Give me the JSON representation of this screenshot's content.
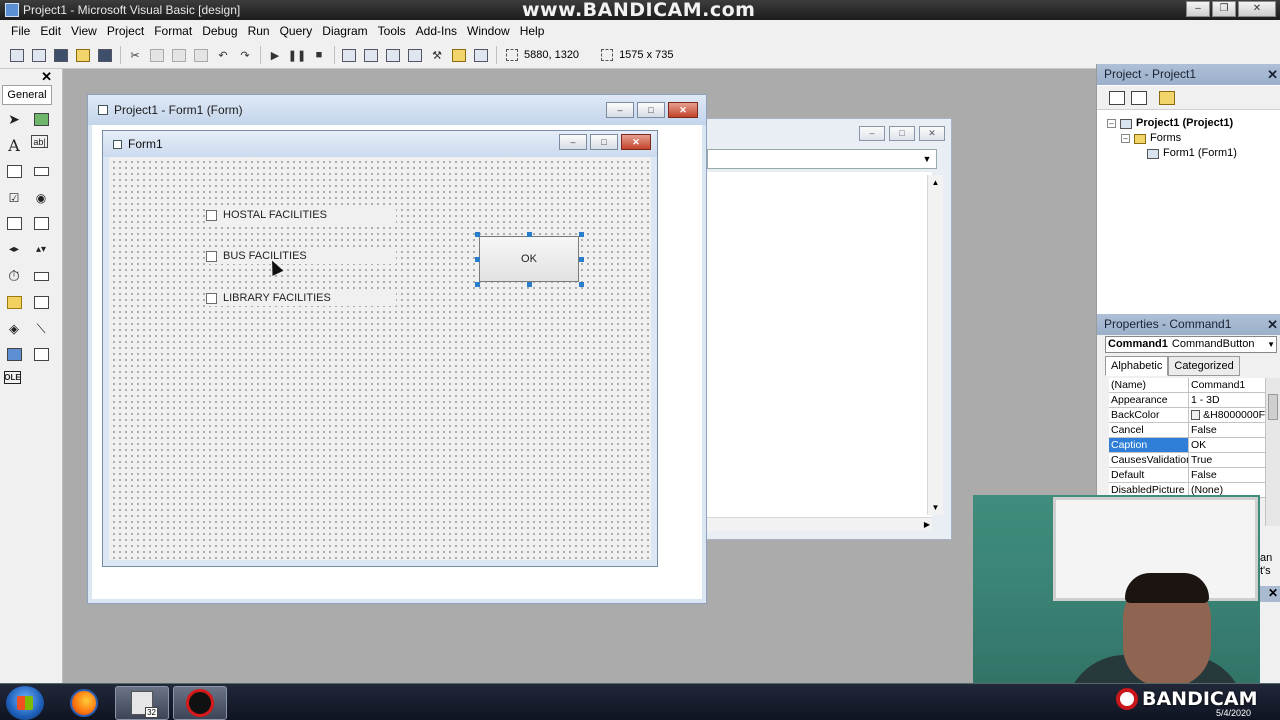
{
  "window": {
    "title": "Project1 - Microsoft Visual Basic [design]",
    "watermark": "www.BANDICAM.com"
  },
  "menu": [
    {
      "label": "File"
    },
    {
      "label": "Edit"
    },
    {
      "label": "View"
    },
    {
      "label": "Project"
    },
    {
      "label": "Format"
    },
    {
      "label": "Debug"
    },
    {
      "label": "Run"
    },
    {
      "label": "Query"
    },
    {
      "label": "Diagram"
    },
    {
      "label": "Tools"
    },
    {
      "label": "Add-Ins"
    },
    {
      "label": "Window"
    },
    {
      "label": "Help"
    }
  ],
  "toolbar": {
    "position": "5880, 1320",
    "size": "1575 x 735"
  },
  "toolbox": {
    "close": "✕",
    "tab": "General"
  },
  "designer": {
    "title": "Project1 - Form1 (Form)",
    "form": {
      "title": "Form1",
      "checkboxes": [
        {
          "label": "HOSTAL FACILITIES"
        },
        {
          "label": "BUS FACILITIES"
        },
        {
          "label": "LIBRARY FACILITIES"
        }
      ],
      "command_button": {
        "caption": "OK"
      }
    }
  },
  "project_panel": {
    "title": "Project - Project1",
    "tree": {
      "root": "Project1 (Project1)",
      "folder": "Forms",
      "item": "Form1 (Form1)"
    }
  },
  "properties_panel": {
    "title": "Properties - Command1",
    "object_name": "Command1",
    "object_type": "CommandButton",
    "tabs": [
      "Alphabetic",
      "Categorized"
    ],
    "rows": [
      {
        "name": "(Name)",
        "value": "Command1"
      },
      {
        "name": "Appearance",
        "value": "1 - 3D"
      },
      {
        "name": "BackColor",
        "value": "&H8000000F"
      },
      {
        "name": "Cancel",
        "value": "False"
      },
      {
        "name": "Caption",
        "value": "OK"
      },
      {
        "name": "CausesValidation",
        "value": "True"
      },
      {
        "name": "Default",
        "value": "False"
      },
      {
        "name": "DisabledPicture",
        "value": "(None)"
      }
    ],
    "selected_row": "Caption",
    "description_fragment": "an\nt's"
  },
  "overlay": {
    "brand": "BANDICAM",
    "date": "5/4/2020"
  },
  "colors": {
    "selection": "#2f7fd8",
    "handle": "#2a7dcc",
    "title_bar": "#1c1c1c"
  }
}
